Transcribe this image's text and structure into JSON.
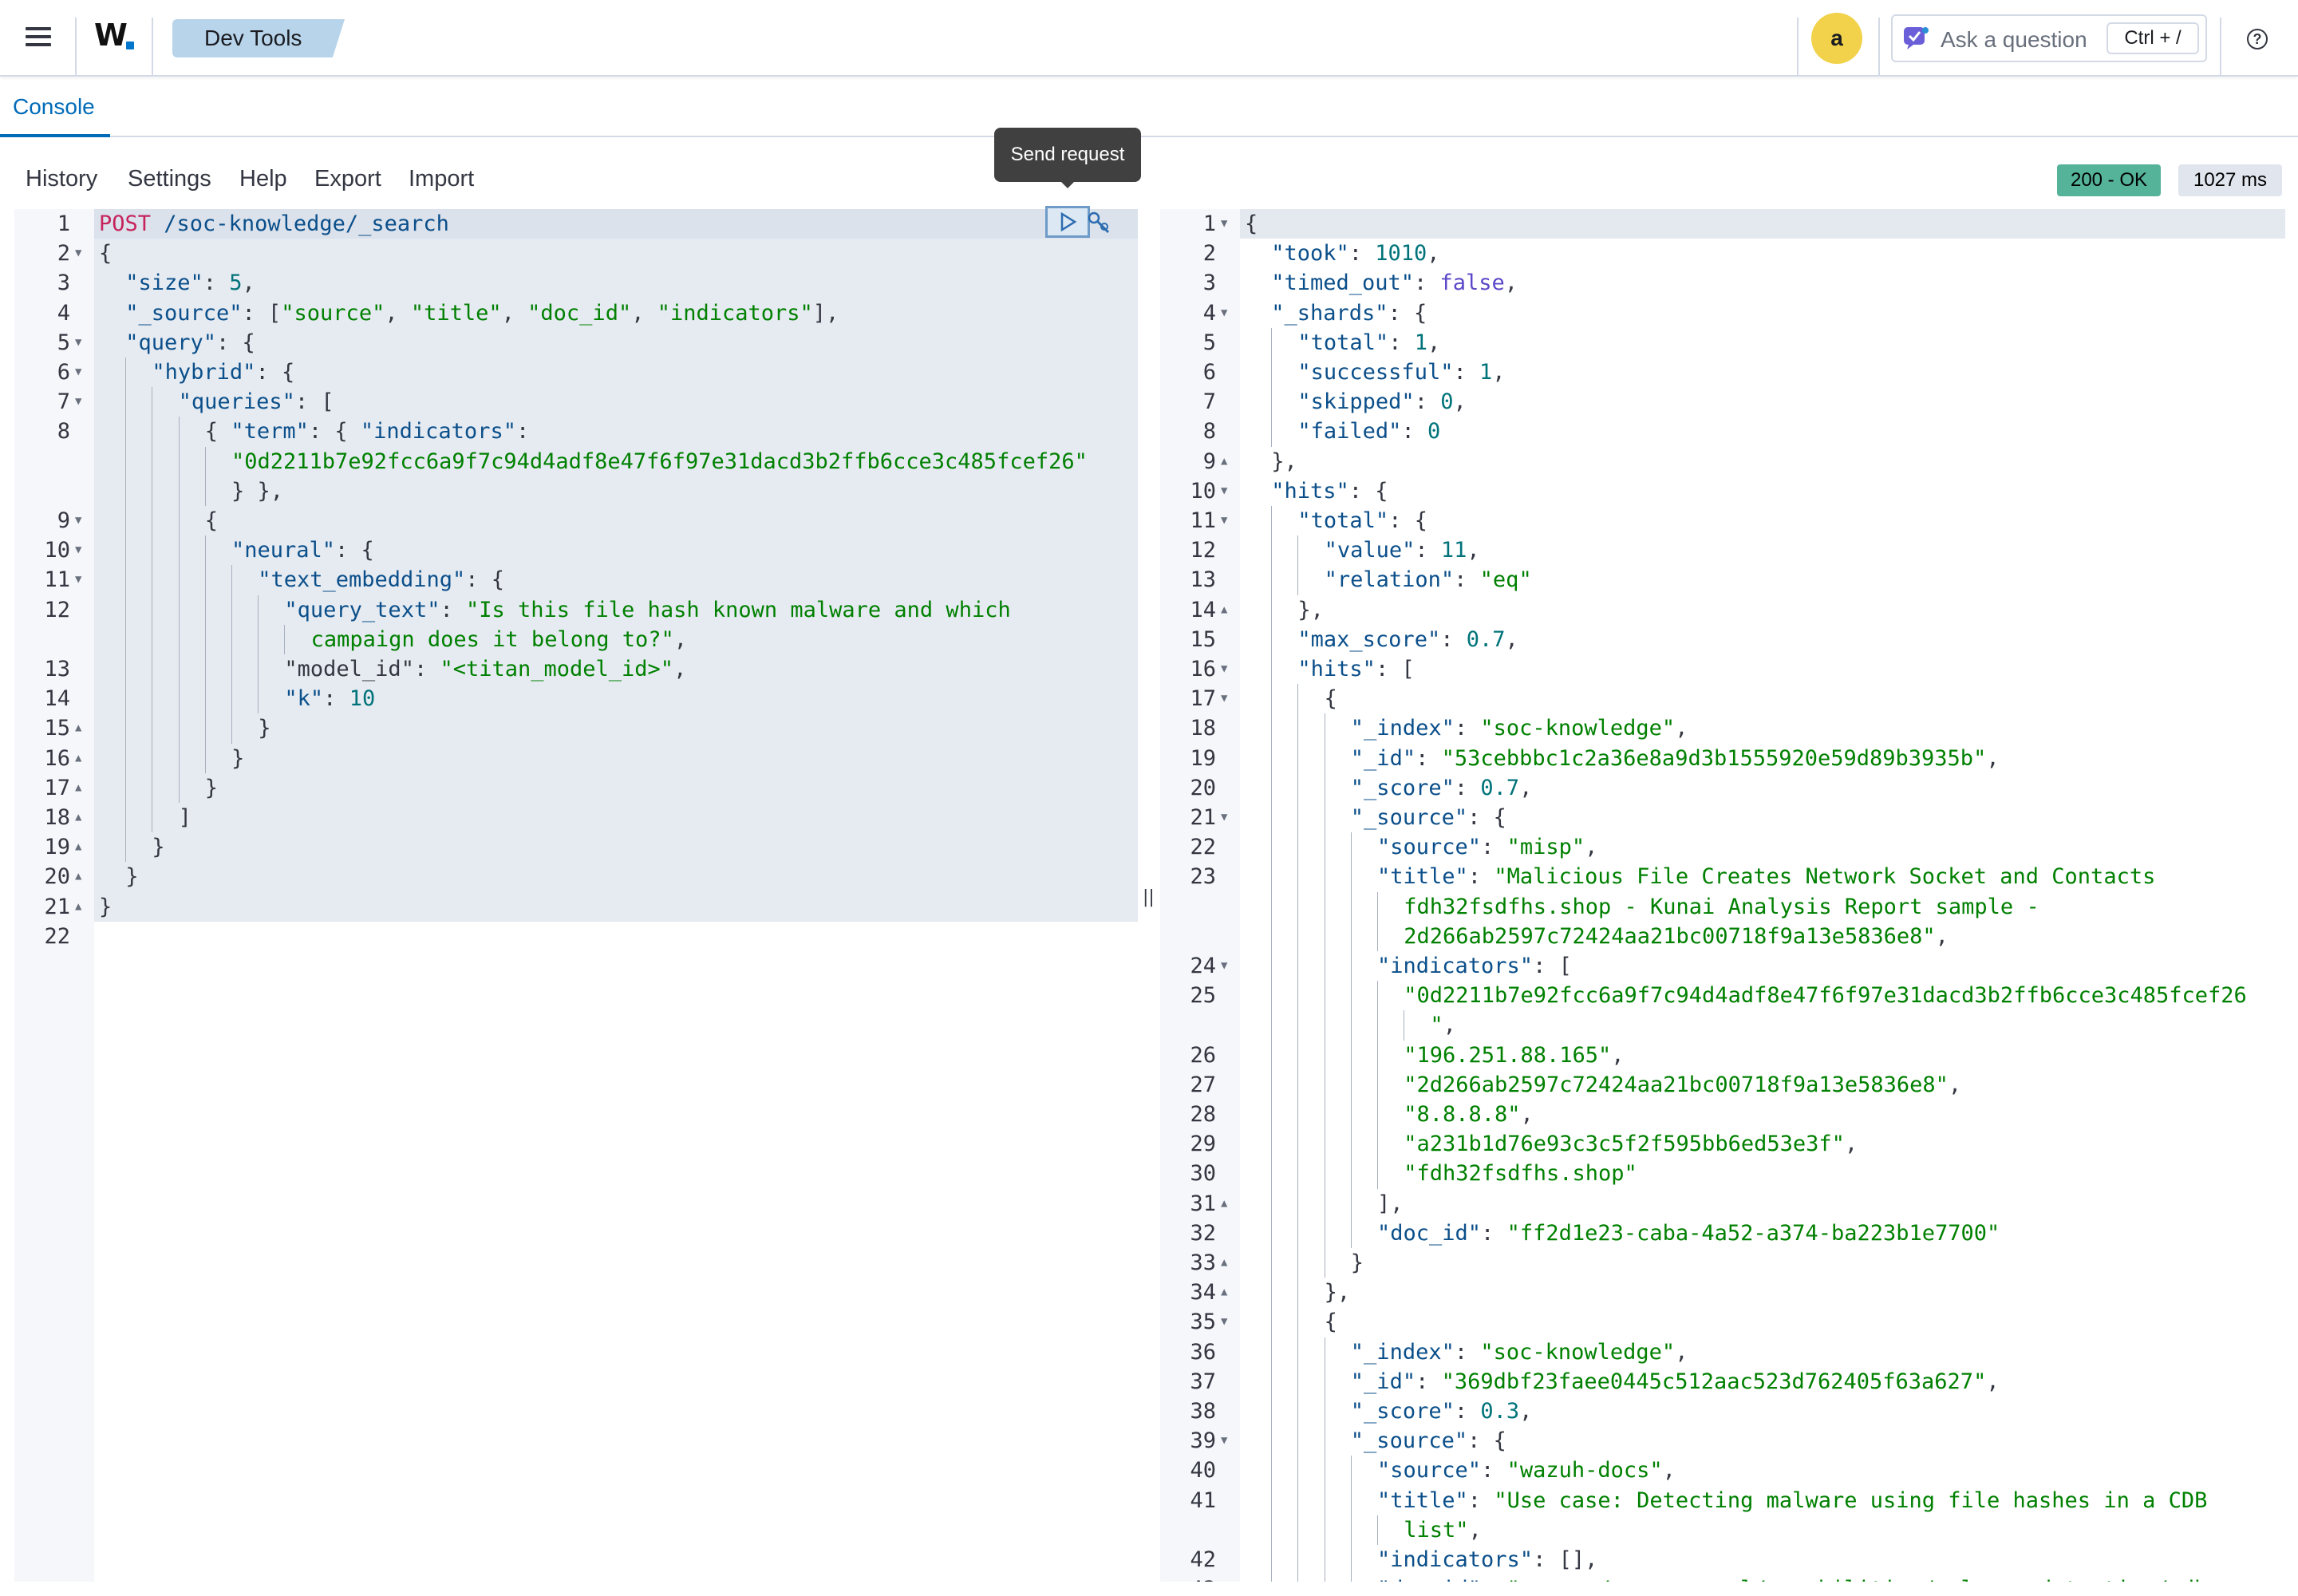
{
  "header": {
    "logo": "W",
    "breadcrumb": "Dev Tools",
    "avatar_letter": "a",
    "ask_placeholder": "Ask a question",
    "ask_shortcut": "Ctrl + /"
  },
  "tabs": [
    {
      "label": "Console",
      "active": true
    }
  ],
  "toolbar": {
    "items": [
      "History",
      "Settings",
      "Help",
      "Export",
      "Import"
    ],
    "send_tooltip": "Send request",
    "status": "200 - OK",
    "time": "1027 ms"
  },
  "colors": {
    "accent": "#006bb8",
    "status_ok": "#54b399",
    "avatar": "#f1d24a",
    "string": "#008000",
    "number": "#00737a",
    "boolean": "#5a48c8",
    "method": "#c6235c"
  },
  "request_editor": {
    "lines": [
      {
        "n": "1",
        "fold": "",
        "indent": 0,
        "tokens": [
          [
            "m",
            "POST"
          ],
          [
            "u",
            " /soc-knowledge/_search"
          ]
        ]
      },
      {
        "n": "2",
        "fold": "down",
        "indent": 0,
        "tokens": [
          [
            "p",
            "{"
          ]
        ]
      },
      {
        "n": "3",
        "fold": "",
        "indent": 1,
        "tokens": [
          [
            "k",
            "\"size\""
          ],
          [
            "p",
            ": "
          ],
          [
            "n",
            "5"
          ],
          [
            "p",
            ","
          ]
        ]
      },
      {
        "n": "4",
        "fold": "",
        "indent": 1,
        "tokens": [
          [
            "k",
            "\"_source\""
          ],
          [
            "p",
            ": ["
          ],
          [
            "s",
            "\"source\""
          ],
          [
            "p",
            ", "
          ],
          [
            "s",
            "\"title\""
          ],
          [
            "p",
            ", "
          ],
          [
            "s",
            "\"doc_id\""
          ],
          [
            "p",
            ", "
          ],
          [
            "s",
            "\"indicators\""
          ],
          [
            "p",
            "],"
          ]
        ]
      },
      {
        "n": "5",
        "fold": "down",
        "indent": 1,
        "tokens": [
          [
            "k",
            "\"query\""
          ],
          [
            "p",
            ": {"
          ]
        ]
      },
      {
        "n": "6",
        "fold": "down",
        "indent": 2,
        "tokens": [
          [
            "k",
            "\"hybrid\""
          ],
          [
            "p",
            ": {"
          ]
        ]
      },
      {
        "n": "7",
        "fold": "down",
        "indent": 3,
        "tokens": [
          [
            "k",
            "\"queries\""
          ],
          [
            "p",
            ": ["
          ]
        ]
      },
      {
        "n": "8",
        "fold": "",
        "indent": 4,
        "tokens": [
          [
            "p",
            "{ "
          ],
          [
            "k",
            "\"term\""
          ],
          [
            "p",
            ": { "
          ],
          [
            "k",
            "\"indicators\""
          ],
          [
            "p",
            ":"
          ]
        ]
      },
      {
        "n": "",
        "fold": "",
        "indent": 5,
        "tokens": [
          [
            "s",
            "\"0d2211b7e92fcc6a9f7c94d4adf8e47f6f97e31dacd3b2ffb6cce3c485fcef26\""
          ]
        ]
      },
      {
        "n": "",
        "fold": "",
        "indent": 5,
        "tokens": [
          [
            "p",
            "} },"
          ]
        ]
      },
      {
        "n": "9",
        "fold": "down",
        "indent": 4,
        "tokens": [
          [
            "p",
            "{"
          ]
        ]
      },
      {
        "n": "10",
        "fold": "down",
        "indent": 5,
        "tokens": [
          [
            "k",
            "\"neural\""
          ],
          [
            "p",
            ": {"
          ]
        ]
      },
      {
        "n": "11",
        "fold": "down",
        "indent": 6,
        "tokens": [
          [
            "k",
            "\"text_embedding\""
          ],
          [
            "p",
            ": {"
          ]
        ]
      },
      {
        "n": "12",
        "fold": "",
        "indent": 7,
        "tokens": [
          [
            "k",
            "\"query_text\""
          ],
          [
            "p",
            ": "
          ],
          [
            "s",
            "\"Is this file hash known malware and which"
          ]
        ]
      },
      {
        "n": "",
        "fold": "",
        "indent": 8,
        "tokens": [
          [
            "s",
            "campaign does it belong to?\""
          ],
          [
            "p",
            ","
          ]
        ]
      },
      {
        "n": "13",
        "fold": "",
        "indent": 7,
        "tokens": [
          [
            "p",
            "\"model_id\": "
          ],
          [
            "s",
            "\"<titan_model_id>\""
          ],
          [
            "p",
            ","
          ]
        ]
      },
      {
        "n": "14",
        "fold": "",
        "indent": 7,
        "tokens": [
          [
            "k",
            "\"k\""
          ],
          [
            "p",
            ": "
          ],
          [
            "n",
            "10"
          ]
        ]
      },
      {
        "n": "15",
        "fold": "up",
        "indent": 6,
        "tokens": [
          [
            "p",
            "}"
          ]
        ]
      },
      {
        "n": "16",
        "fold": "up",
        "indent": 5,
        "tokens": [
          [
            "p",
            "}"
          ]
        ]
      },
      {
        "n": "17",
        "fold": "up",
        "indent": 4,
        "tokens": [
          [
            "p",
            "}"
          ]
        ]
      },
      {
        "n": "18",
        "fold": "up",
        "indent": 3,
        "tokens": [
          [
            "p",
            "]"
          ]
        ]
      },
      {
        "n": "19",
        "fold": "up",
        "indent": 2,
        "tokens": [
          [
            "p",
            "}"
          ]
        ]
      },
      {
        "n": "20",
        "fold": "up",
        "indent": 1,
        "tokens": [
          [
            "p",
            "}"
          ]
        ]
      },
      {
        "n": "21",
        "fold": "up",
        "indent": 0,
        "tokens": [
          [
            "p",
            "}"
          ]
        ]
      },
      {
        "n": "22",
        "fold": "",
        "indent": 0,
        "tokens": []
      }
    ]
  },
  "response_editor": {
    "lines": [
      {
        "n": "1",
        "fold": "down",
        "indent": 0,
        "tokens": [
          [
            "p",
            "{"
          ]
        ]
      },
      {
        "n": "2",
        "fold": "",
        "indent": 1,
        "tokens": [
          [
            "k",
            "\"took\""
          ],
          [
            "p",
            ": "
          ],
          [
            "n",
            "1010"
          ],
          [
            "p",
            ","
          ]
        ]
      },
      {
        "n": "3",
        "fold": "",
        "indent": 1,
        "tokens": [
          [
            "k",
            "\"timed_out\""
          ],
          [
            "p",
            ": "
          ],
          [
            "b",
            "false"
          ],
          [
            "p",
            ","
          ]
        ]
      },
      {
        "n": "4",
        "fold": "down",
        "indent": 1,
        "tokens": [
          [
            "k",
            "\"_shards\""
          ],
          [
            "p",
            ": {"
          ]
        ]
      },
      {
        "n": "5",
        "fold": "",
        "indent": 2,
        "tokens": [
          [
            "k",
            "\"total\""
          ],
          [
            "p",
            ": "
          ],
          [
            "n",
            "1"
          ],
          [
            "p",
            ","
          ]
        ]
      },
      {
        "n": "6",
        "fold": "",
        "indent": 2,
        "tokens": [
          [
            "k",
            "\"successful\""
          ],
          [
            "p",
            ": "
          ],
          [
            "n",
            "1"
          ],
          [
            "p",
            ","
          ]
        ]
      },
      {
        "n": "7",
        "fold": "",
        "indent": 2,
        "tokens": [
          [
            "k",
            "\"skipped\""
          ],
          [
            "p",
            ": "
          ],
          [
            "n",
            "0"
          ],
          [
            "p",
            ","
          ]
        ]
      },
      {
        "n": "8",
        "fold": "",
        "indent": 2,
        "tokens": [
          [
            "k",
            "\"failed\""
          ],
          [
            "p",
            ": "
          ],
          [
            "n",
            "0"
          ]
        ]
      },
      {
        "n": "9",
        "fold": "up",
        "indent": 1,
        "tokens": [
          [
            "p",
            "},"
          ]
        ]
      },
      {
        "n": "10",
        "fold": "down",
        "indent": 1,
        "tokens": [
          [
            "k",
            "\"hits\""
          ],
          [
            "p",
            ": {"
          ]
        ]
      },
      {
        "n": "11",
        "fold": "down",
        "indent": 2,
        "tokens": [
          [
            "k",
            "\"total\""
          ],
          [
            "p",
            ": {"
          ]
        ]
      },
      {
        "n": "12",
        "fold": "",
        "indent": 3,
        "tokens": [
          [
            "k",
            "\"value\""
          ],
          [
            "p",
            ": "
          ],
          [
            "n",
            "11"
          ],
          [
            "p",
            ","
          ]
        ]
      },
      {
        "n": "13",
        "fold": "",
        "indent": 3,
        "tokens": [
          [
            "k",
            "\"relation\""
          ],
          [
            "p",
            ": "
          ],
          [
            "s",
            "\"eq\""
          ]
        ]
      },
      {
        "n": "14",
        "fold": "up",
        "indent": 2,
        "tokens": [
          [
            "p",
            "},"
          ]
        ]
      },
      {
        "n": "15",
        "fold": "",
        "indent": 2,
        "tokens": [
          [
            "k",
            "\"max_score\""
          ],
          [
            "p",
            ": "
          ],
          [
            "n",
            "0.7"
          ],
          [
            "p",
            ","
          ]
        ]
      },
      {
        "n": "16",
        "fold": "down",
        "indent": 2,
        "tokens": [
          [
            "k",
            "\"hits\""
          ],
          [
            "p",
            ": ["
          ]
        ]
      },
      {
        "n": "17",
        "fold": "down",
        "indent": 3,
        "tokens": [
          [
            "p",
            "{"
          ]
        ]
      },
      {
        "n": "18",
        "fold": "",
        "indent": 4,
        "tokens": [
          [
            "k",
            "\"_index\""
          ],
          [
            "p",
            ": "
          ],
          [
            "s",
            "\"soc-knowledge\""
          ],
          [
            "p",
            ","
          ]
        ]
      },
      {
        "n": "19",
        "fold": "",
        "indent": 4,
        "tokens": [
          [
            "k",
            "\"_id\""
          ],
          [
            "p",
            ": "
          ],
          [
            "s",
            "\"53cebbbc1c2a36e8a9d3b1555920e59d89b3935b\""
          ],
          [
            "p",
            ","
          ]
        ]
      },
      {
        "n": "20",
        "fold": "",
        "indent": 4,
        "tokens": [
          [
            "k",
            "\"_score\""
          ],
          [
            "p",
            ": "
          ],
          [
            "n",
            "0.7"
          ],
          [
            "p",
            ","
          ]
        ]
      },
      {
        "n": "21",
        "fold": "down",
        "indent": 4,
        "tokens": [
          [
            "k",
            "\"_source\""
          ],
          [
            "p",
            ": {"
          ]
        ]
      },
      {
        "n": "22",
        "fold": "",
        "indent": 5,
        "tokens": [
          [
            "k",
            "\"source\""
          ],
          [
            "p",
            ": "
          ],
          [
            "s",
            "\"misp\""
          ],
          [
            "p",
            ","
          ]
        ]
      },
      {
        "n": "23",
        "fold": "",
        "indent": 5,
        "tokens": [
          [
            "k",
            "\"title\""
          ],
          [
            "p",
            ": "
          ],
          [
            "s",
            "\"Malicious File Creates Network Socket and Contacts"
          ]
        ]
      },
      {
        "n": "",
        "fold": "",
        "indent": 6,
        "tokens": [
          [
            "s",
            "fdh32fsdfhs.shop - Kunai Analysis Report sample -"
          ]
        ]
      },
      {
        "n": "",
        "fold": "",
        "indent": 6,
        "tokens": [
          [
            "s",
            "2d266ab2597c72424aa21bc00718f9a13e5836e8\""
          ],
          [
            "p",
            ","
          ]
        ]
      },
      {
        "n": "24",
        "fold": "down",
        "indent": 5,
        "tokens": [
          [
            "k",
            "\"indicators\""
          ],
          [
            "p",
            ": ["
          ]
        ]
      },
      {
        "n": "25",
        "fold": "",
        "indent": 6,
        "tokens": [
          [
            "s",
            "\"0d2211b7e92fcc6a9f7c94d4adf8e47f6f97e31dacd3b2ffb6cce3c485fcef26"
          ]
        ]
      },
      {
        "n": "",
        "fold": "",
        "indent": 7,
        "tokens": [
          [
            "s",
            "\""
          ],
          [
            "p",
            ","
          ]
        ]
      },
      {
        "n": "26",
        "fold": "",
        "indent": 6,
        "tokens": [
          [
            "s",
            "\"196.251.88.165\""
          ],
          [
            "p",
            ","
          ]
        ]
      },
      {
        "n": "27",
        "fold": "",
        "indent": 6,
        "tokens": [
          [
            "s",
            "\"2d266ab2597c72424aa21bc00718f9a13e5836e8\""
          ],
          [
            "p",
            ","
          ]
        ]
      },
      {
        "n": "28",
        "fold": "",
        "indent": 6,
        "tokens": [
          [
            "s",
            "\"8.8.8.8\""
          ],
          [
            "p",
            ","
          ]
        ]
      },
      {
        "n": "29",
        "fold": "",
        "indent": 6,
        "tokens": [
          [
            "s",
            "\"a231b1d76e93c3c5f2f595bb6ed53e3f\""
          ],
          [
            "p",
            ","
          ]
        ]
      },
      {
        "n": "30",
        "fold": "",
        "indent": 6,
        "tokens": [
          [
            "s",
            "\"fdh32fsdfhs.shop\""
          ]
        ]
      },
      {
        "n": "31",
        "fold": "up",
        "indent": 5,
        "tokens": [
          [
            "p",
            "],"
          ]
        ]
      },
      {
        "n": "32",
        "fold": "",
        "indent": 5,
        "tokens": [
          [
            "k",
            "\"doc_id\""
          ],
          [
            "p",
            ": "
          ],
          [
            "s",
            "\"ff2d1e23-caba-4a52-a374-ba223b1e7700\""
          ]
        ]
      },
      {
        "n": "33",
        "fold": "up",
        "indent": 4,
        "tokens": [
          [
            "p",
            "}"
          ]
        ]
      },
      {
        "n": "34",
        "fold": "up",
        "indent": 3,
        "tokens": [
          [
            "p",
            "},"
          ]
        ]
      },
      {
        "n": "35",
        "fold": "down",
        "indent": 3,
        "tokens": [
          [
            "p",
            "{"
          ]
        ]
      },
      {
        "n": "36",
        "fold": "",
        "indent": 4,
        "tokens": [
          [
            "k",
            "\"_index\""
          ],
          [
            "p",
            ": "
          ],
          [
            "s",
            "\"soc-knowledge\""
          ],
          [
            "p",
            ","
          ]
        ]
      },
      {
        "n": "37",
        "fold": "",
        "indent": 4,
        "tokens": [
          [
            "k",
            "\"_id\""
          ],
          [
            "p",
            ": "
          ],
          [
            "s",
            "\"369dbf23faee0445c512aac523d762405f63a627\""
          ],
          [
            "p",
            ","
          ]
        ]
      },
      {
        "n": "38",
        "fold": "",
        "indent": 4,
        "tokens": [
          [
            "k",
            "\"_score\""
          ],
          [
            "p",
            ": "
          ],
          [
            "n",
            "0.3"
          ],
          [
            "p",
            ","
          ]
        ]
      },
      {
        "n": "39",
        "fold": "down",
        "indent": 4,
        "tokens": [
          [
            "k",
            "\"_source\""
          ],
          [
            "p",
            ": {"
          ]
        ]
      },
      {
        "n": "40",
        "fold": "",
        "indent": 5,
        "tokens": [
          [
            "k",
            "\"source\""
          ],
          [
            "p",
            ": "
          ],
          [
            "s",
            "\"wazuh-docs\""
          ],
          [
            "p",
            ","
          ]
        ]
      },
      {
        "n": "41",
        "fold": "",
        "indent": 5,
        "tokens": [
          [
            "k",
            "\"title\""
          ],
          [
            "p",
            ": "
          ],
          [
            "s",
            "\"Use case: Detecting malware using file hashes in a CDB"
          ]
        ]
      },
      {
        "n": "",
        "fold": "",
        "indent": 6,
        "tokens": [
          [
            "s",
            "list\""
          ],
          [
            "p",
            ","
          ]
        ]
      },
      {
        "n": "42",
        "fold": "",
        "indent": 5,
        "tokens": [
          [
            "k",
            "\"indicators\""
          ],
          [
            "p",
            ": [],"
          ]
        ]
      },
      {
        "n": "43",
        "fold": "",
        "indent": 5,
        "tokens": [
          [
            "k",
            "\"doc_id\""
          ],
          [
            "p",
            ": "
          ],
          [
            "s",
            "\"source/user-manual/capabilities/malware-detection/cdb"
          ]
        ]
      }
    ]
  }
}
